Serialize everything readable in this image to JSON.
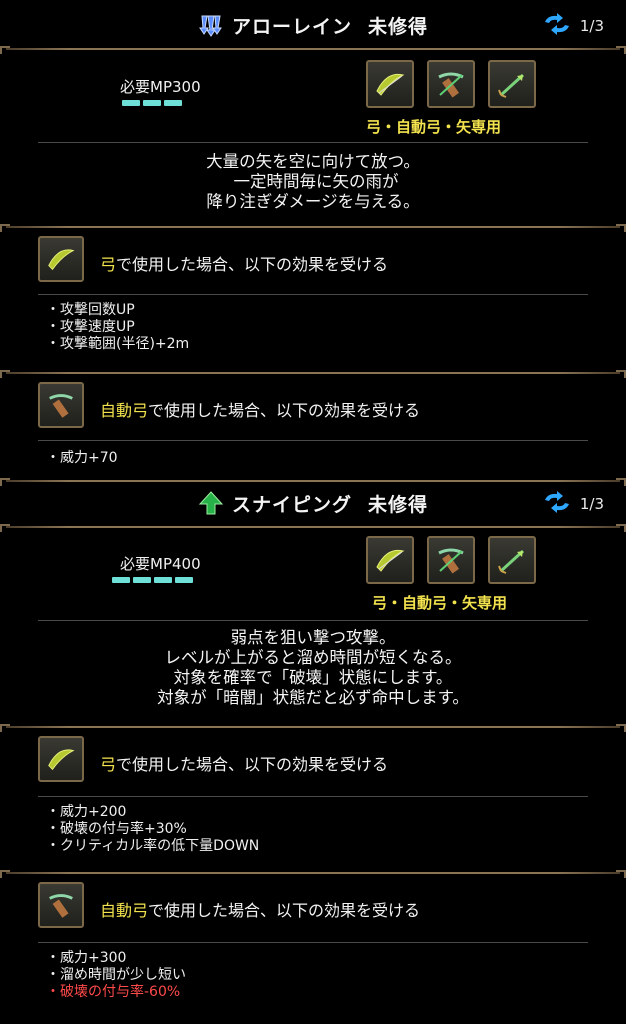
{
  "skills": [
    {
      "name": "アローレイン",
      "status": "未修得",
      "page": "1/3",
      "mp": "必要MP300",
      "mp_pips": 3,
      "weapons_label_parts": [
        "弓・自動弓・矢",
        "専用"
      ],
      "description": [
        "大量の矢を空に向けて放つ。",
        "一定時間毎に矢の雨が",
        "降り注ぎダメージを与える。"
      ],
      "effects": [
        {
          "weapon": "弓",
          "suffix": "で使用した場合、以下の効果を受ける",
          "items": [
            {
              "text": "攻撃回数UP",
              "neg": false
            },
            {
              "text": "攻撃速度UP",
              "neg": false
            },
            {
              "text": "攻撃範囲(半径)+2m",
              "neg": false
            }
          ]
        },
        {
          "weapon": "自動弓",
          "suffix": "で使用した場合、以下の効果を受ける",
          "items": [
            {
              "text": "威力+70",
              "neg": false
            }
          ]
        }
      ]
    },
    {
      "name": "スナイピング",
      "status": "未修得",
      "page": "1/3",
      "mp": "必要MP400",
      "mp_pips": 4,
      "weapons_label_parts": [
        "弓・自動弓・矢",
        "専用"
      ],
      "description": [
        "弱点を狙い撃つ攻撃。",
        "レベルが上がると溜め時間が短くなる。",
        "対象を確率で「破壊」状態にします。",
        "対象が「暗闇」状態だと必ず命中します。"
      ],
      "effects": [
        {
          "weapon": "弓",
          "suffix": "で使用した場合、以下の効果を受ける",
          "items": [
            {
              "text": "威力+200",
              "neg": false
            },
            {
              "text": "破壊の付与率+30%",
              "neg": false
            },
            {
              "text": "クリティカル率の低下量DOWN",
              "neg": false
            }
          ]
        },
        {
          "weapon": "自動弓",
          "suffix": "で使用した場合、以下の効果を受ける",
          "items": [
            {
              "text": "威力+300",
              "neg": false
            },
            {
              "text": "溜め時間が少し短い",
              "neg": false
            },
            {
              "text": "破壊の付与率-60%",
              "neg": true
            }
          ]
        }
      ]
    }
  ],
  "colors": {
    "accent_yellow": "#f2e24d",
    "mp_cyan": "#6fe0d8",
    "negative_red": "#ff4a4a",
    "frame_gold": "#7a6848"
  },
  "icons": {
    "skill1": "triple-arrow-down-icon",
    "skill2": "arrow-up-icon",
    "page": "cycle-arrows-icon",
    "weapons": [
      "bow-icon",
      "crossbow-icon",
      "arrow-icon"
    ]
  }
}
